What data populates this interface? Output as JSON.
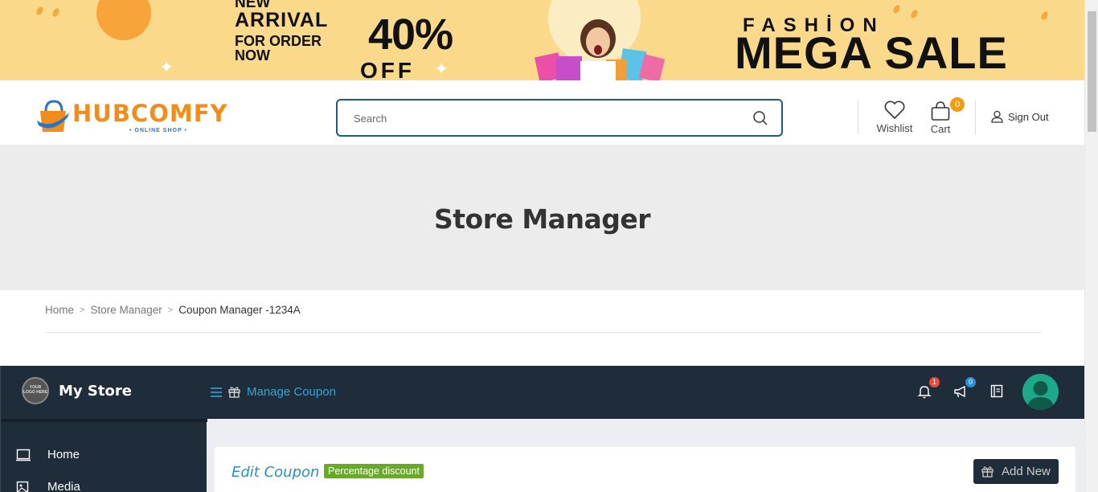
{
  "banner": {
    "arrival_line1": "NEW",
    "arrival_line2": "ARRIVAL",
    "arrival_line3": "FOR ORDER",
    "arrival_line4": "NOW",
    "discount": "40%",
    "discount_suffix": "OFF",
    "fashion": "FASHİON",
    "mega_sale": "MEGA SALE"
  },
  "header": {
    "logo_name": "HUBCOMFY",
    "logo_sub": "• ONLINE SHOP •",
    "search_placeholder": "Search",
    "wishlist_label": "Wishlist",
    "cart_label": "Cart",
    "cart_count": "0",
    "signout_label": "Sign Out"
  },
  "hero": {
    "title": "Store Manager"
  },
  "breadcrumb": {
    "items": [
      "Home",
      "Store Manager",
      "Coupon Manager -1234A"
    ]
  },
  "dashboard": {
    "store_logo_text": "YOUR LOGO HERE",
    "store_name": "My Store",
    "manage_label": "Manage Coupon",
    "notifications_count": "1",
    "announcements_count": "0",
    "sidebar": [
      {
        "label": "Home",
        "icon": "monitor-icon"
      },
      {
        "label": "Media",
        "icon": "image-icon"
      }
    ],
    "edit_title": "Edit Coupon",
    "discount_type": "Percentage discount",
    "add_new_label": "Add New"
  },
  "colors": {
    "banner_bg": "#fad98a",
    "brand_orange": "#f28c1a",
    "search_border": "#1d5a7d",
    "dash_bg": "#1f2d3a",
    "accent_blue": "#2ea7d8",
    "badge_green": "#68a92a",
    "cart_badge": "#f39c12"
  }
}
